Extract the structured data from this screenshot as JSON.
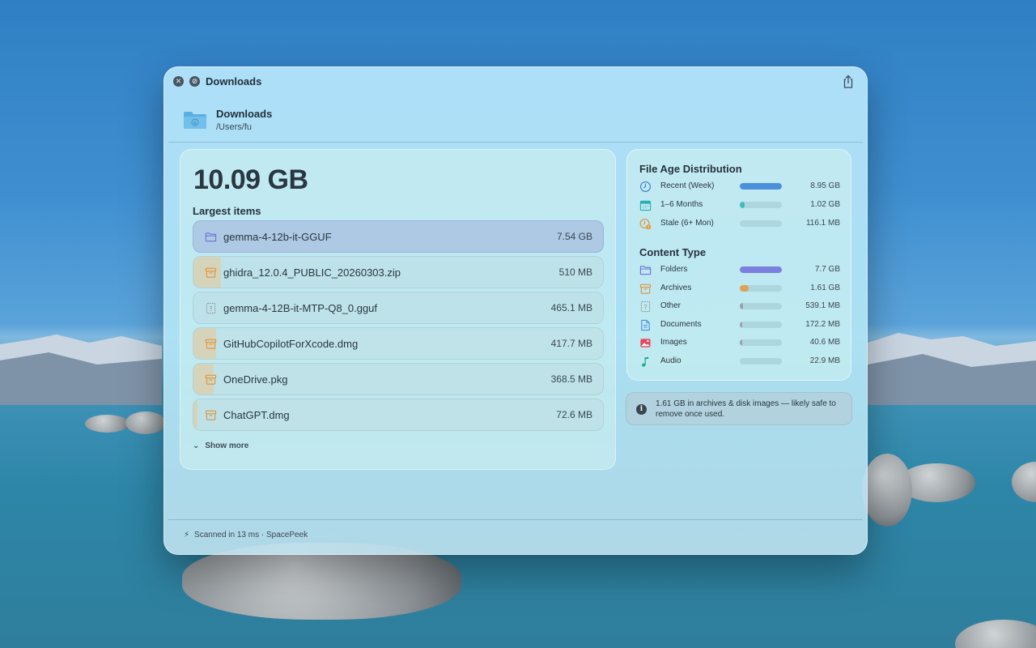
{
  "window": {
    "title": "Downloads",
    "close_icon": "close-icon",
    "minimize_icon": "minimize-icon",
    "share_icon": "share-icon"
  },
  "header": {
    "name": "Downloads",
    "path": "/Users/fu",
    "icon": "folder-download-icon"
  },
  "summary": {
    "total_size": "10.09 GB",
    "largest_title": "Largest items",
    "show_more": "Show more"
  },
  "largest_items": [
    {
      "name": "gemma-4-12b-it-GGUF",
      "size": "7.54 GB",
      "icon": "folder-icon",
      "kind": "folder",
      "selected": true,
      "fraction": 0
    },
    {
      "name": "ghidra_12.0.4_PUBLIC_20260303.zip",
      "size": "510 MB",
      "icon": "archive-icon",
      "kind": "archive",
      "selected": false,
      "fraction": 0.068
    },
    {
      "name": "gemma-4-12B-it-MTP-Q8_0.gguf",
      "size": "465.1 MB",
      "icon": "unknown-file-icon",
      "kind": "other",
      "selected": false,
      "fraction": 0
    },
    {
      "name": "GitHubCopilotForXcode.dmg",
      "size": "417.7 MB",
      "icon": "archive-icon",
      "kind": "archive",
      "selected": false,
      "fraction": 0.055
    },
    {
      "name": "OneDrive.pkg",
      "size": "368.5 MB",
      "icon": "archive-icon",
      "kind": "archive",
      "selected": false,
      "fraction": 0.049
    },
    {
      "name": "ChatGPT.dmg",
      "size": "72.6 MB",
      "icon": "archive-icon",
      "kind": "archive",
      "selected": false,
      "fraction": 0.01
    }
  ],
  "age_distribution": {
    "title": "File Age Distribution",
    "rows": [
      {
        "label": "Recent (Week)",
        "value": "8.95 GB",
        "fraction": 1.0,
        "color": "#4a90dc",
        "icon": "clock-icon"
      },
      {
        "label": "1–6 Months",
        "value": "1.02 GB",
        "fraction": 0.11,
        "color": "#3cbdbd",
        "icon": "calendar-icon"
      },
      {
        "label": "Stale (6+ Mon)",
        "value": "116.1 MB",
        "fraction": 0.0,
        "color": "#e0952f",
        "icon": "stale-clock-icon"
      }
    ]
  },
  "content_type": {
    "title": "Content Type",
    "rows": [
      {
        "label": "Folders",
        "value": "7.7 GB",
        "fraction": 1.0,
        "color": "#7b7fe0",
        "icon": "folder-icon"
      },
      {
        "label": "Archives",
        "value": "1.61 GB",
        "fraction": 0.21,
        "color": "#e0a050",
        "icon": "archive-icon"
      },
      {
        "label": "Other",
        "value": "539.1 MB",
        "fraction": 0.07,
        "color": "#9aa0a6",
        "icon": "unknown-file-icon"
      },
      {
        "label": "Documents",
        "value": "172.2 MB",
        "fraction": 0.02,
        "color": "#9aa0a6",
        "icon": "document-icon"
      },
      {
        "label": "Images",
        "value": "40.6 MB",
        "fraction": 0.01,
        "color": "#9aa0a6",
        "icon": "image-icon"
      },
      {
        "label": "Audio",
        "value": "22.9 MB",
        "fraction": 0.0,
        "color": "#9aa0a6",
        "icon": "music-note-icon"
      }
    ]
  },
  "tip": {
    "icon": "info-icon",
    "text": "1.61 GB in archives & disk images — likely safe to remove once used."
  },
  "footer": {
    "icon": "bolt-icon",
    "text": "Scanned in 13 ms · SpacePeek"
  }
}
